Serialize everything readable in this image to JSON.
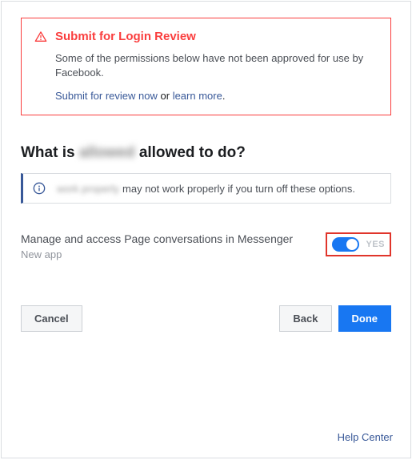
{
  "alert": {
    "title": "Submit for Login Review",
    "body": "Some of the permissions below have not been approved for use by Facebook.",
    "submit_link": "Submit for review now",
    "or_text": " or ",
    "learn_link": "learn more",
    "period": "."
  },
  "heading": {
    "prefix": "What is ",
    "app_name": "allowed",
    "suffix": "allowed to do?"
  },
  "info_banner": {
    "hidden_text": "work properly",
    "text": "may not work properly if you turn off these options."
  },
  "permission": {
    "label": "Manage and access Page conversations in Messenger",
    "sub": "New app",
    "toggle_state": "YES"
  },
  "buttons": {
    "cancel": "Cancel",
    "back": "Back",
    "done": "Done"
  },
  "footer": {
    "help": "Help Center"
  }
}
